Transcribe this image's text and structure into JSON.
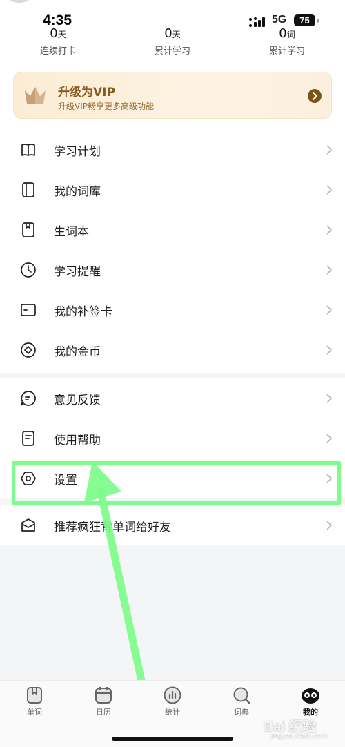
{
  "status_bar": {
    "time": "4:35",
    "network": "5G",
    "battery": "75"
  },
  "stats": [
    {
      "value": "0",
      "unit": "天",
      "label": "连续打卡"
    },
    {
      "value": "0",
      "unit": "天",
      "label": "累计学习"
    },
    {
      "value": "0",
      "unit": "词",
      "label": "累计学习"
    }
  ],
  "vip": {
    "title": "升级为VIP",
    "subtitle": "升级VIP畅享更多高级功能"
  },
  "menu_group_1": [
    {
      "label": "学习计划",
      "icon": "book-icon"
    },
    {
      "label": "我的词库",
      "icon": "wordbank-icon"
    },
    {
      "label": "生词本",
      "icon": "notebook-icon"
    },
    {
      "label": "学习提醒",
      "icon": "clock-icon"
    },
    {
      "label": "我的补签卡",
      "icon": "card-icon"
    },
    {
      "label": "我的金币",
      "icon": "coin-icon"
    }
  ],
  "menu_group_2": [
    {
      "label": "意见反馈",
      "icon": "chat-icon"
    },
    {
      "label": "使用帮助",
      "icon": "help-doc-icon"
    },
    {
      "label": "设置",
      "icon": "settings-hex-icon"
    }
  ],
  "menu_group_3": [
    {
      "label": "推荐疯狂背单词给好友",
      "icon": "share-envelope-icon"
    }
  ],
  "tabs": [
    {
      "label": "单词",
      "icon": "word-tab-icon",
      "active": false
    },
    {
      "label": "日历",
      "icon": "calendar-tab-icon",
      "active": false
    },
    {
      "label": "统计",
      "icon": "stats-tab-icon",
      "active": false
    },
    {
      "label": "词典",
      "icon": "dictionary-tab-icon",
      "active": false
    },
    {
      "label": "我的",
      "icon": "profile-tab-icon",
      "active": true
    }
  ],
  "colors": {
    "highlight": "#7cfc8a",
    "vip_text": "#8a5a1f",
    "accent_brown": "#7b5418"
  },
  "watermark": {
    "text": "Bai 经验",
    "sub": "jingyan.baidu.com"
  }
}
